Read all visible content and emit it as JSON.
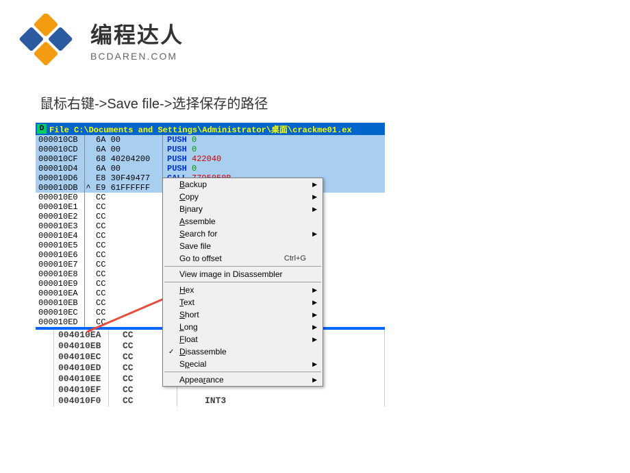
{
  "logo": {
    "cn": "编程达人",
    "en": "BCDAREN.COM",
    "color1": "#f39c12",
    "color2": "#2c5aa0"
  },
  "instruction": "鼠标右键->Save file->选择保存的路径",
  "window": {
    "icon": "D",
    "title": "File C:\\Documents and Settings\\Administrator\\桌面\\crackme01.ex"
  },
  "asm_top": [
    {
      "addr": "000010CB",
      "marker": "",
      "bytes": "6A 00",
      "mnem": "PUSH",
      "arg": "0",
      "argclass": "zero"
    },
    {
      "addr": "000010CD",
      "marker": "",
      "bytes": "6A 00",
      "mnem": "PUSH",
      "arg": "0",
      "argclass": "zero"
    },
    {
      "addr": "000010CF",
      "marker": "",
      "bytes": "68 40204200",
      "mnem": "PUSH",
      "arg": "422040",
      "argclass": "num"
    },
    {
      "addr": "000010D4",
      "marker": "",
      "bytes": "6A 00",
      "mnem": "PUSH",
      "arg": "0",
      "argclass": "zero"
    },
    {
      "addr": "000010D6",
      "marker": "",
      "bytes": "E8 30F49477",
      "mnem": "CALL",
      "arg": "7795050B",
      "argclass": "num"
    },
    {
      "addr": "000010DB",
      "marker": "^",
      "bytes": "E9 61FFFFFF",
      "mnem": "",
      "arg": "",
      "argclass": ""
    }
  ],
  "asm_bottom": [
    {
      "addr": "000010E0",
      "bytes": "CC"
    },
    {
      "addr": "000010E1",
      "bytes": "CC"
    },
    {
      "addr": "000010E2",
      "bytes": "CC"
    },
    {
      "addr": "000010E3",
      "bytes": "CC"
    },
    {
      "addr": "000010E4",
      "bytes": "CC"
    },
    {
      "addr": "000010E5",
      "bytes": "CC"
    },
    {
      "addr": "000010E6",
      "bytes": "CC"
    },
    {
      "addr": "000010E7",
      "bytes": "CC"
    },
    {
      "addr": "000010E8",
      "bytes": "CC"
    },
    {
      "addr": "000010E9",
      "bytes": "CC"
    },
    {
      "addr": "000010EA",
      "bytes": "CC"
    },
    {
      "addr": "000010EB",
      "bytes": "CC"
    },
    {
      "addr": "000010EC",
      "bytes": "CC"
    },
    {
      "addr": "000010ED",
      "bytes": "CC"
    }
  ],
  "menu": {
    "items": [
      {
        "label": "Backup",
        "u": 0,
        "arrow": true
      },
      {
        "label": "Copy",
        "u": 0,
        "arrow": true
      },
      {
        "label": "Binary",
        "u": 1,
        "arrow": true
      },
      {
        "label": "Assemble",
        "u": 0
      },
      {
        "label": "Search for",
        "u": 0,
        "arrow": true
      },
      {
        "label": "Save file"
      },
      {
        "label": "Go to offset",
        "shortcut": "Ctrl+G"
      },
      {
        "sep": true
      },
      {
        "label": "View image in Disassembler"
      },
      {
        "sep": true
      },
      {
        "label": "Hex",
        "u": 0,
        "arrow": true
      },
      {
        "label": "Text",
        "u": 0,
        "arrow": true
      },
      {
        "label": "Short",
        "u": 0,
        "arrow": true
      },
      {
        "label": "Long",
        "u": 0,
        "arrow": true
      },
      {
        "label": "Float",
        "u": 0,
        "arrow": true
      },
      {
        "label": "Disassemble",
        "u": 0,
        "check": true
      },
      {
        "label": "Special",
        "u": 1,
        "arrow": true
      },
      {
        "sep": true
      },
      {
        "label": "Appearance",
        "u": 5,
        "arrow": true
      }
    ]
  },
  "lower": [
    {
      "addr": "004010EA",
      "bytes": "CC",
      "instr": ""
    },
    {
      "addr": "004010EB",
      "bytes": "CC",
      "instr": ""
    },
    {
      "addr": "004010EC",
      "bytes": "CC",
      "instr": ""
    },
    {
      "addr": "004010ED",
      "bytes": "CC",
      "instr": ""
    },
    {
      "addr": "004010EE",
      "bytes": "CC",
      "instr": ""
    },
    {
      "addr": "004010EF",
      "bytes": "CC",
      "instr": ""
    },
    {
      "addr": "004010F0",
      "bytes": "CC",
      "instr": "INT3"
    }
  ]
}
